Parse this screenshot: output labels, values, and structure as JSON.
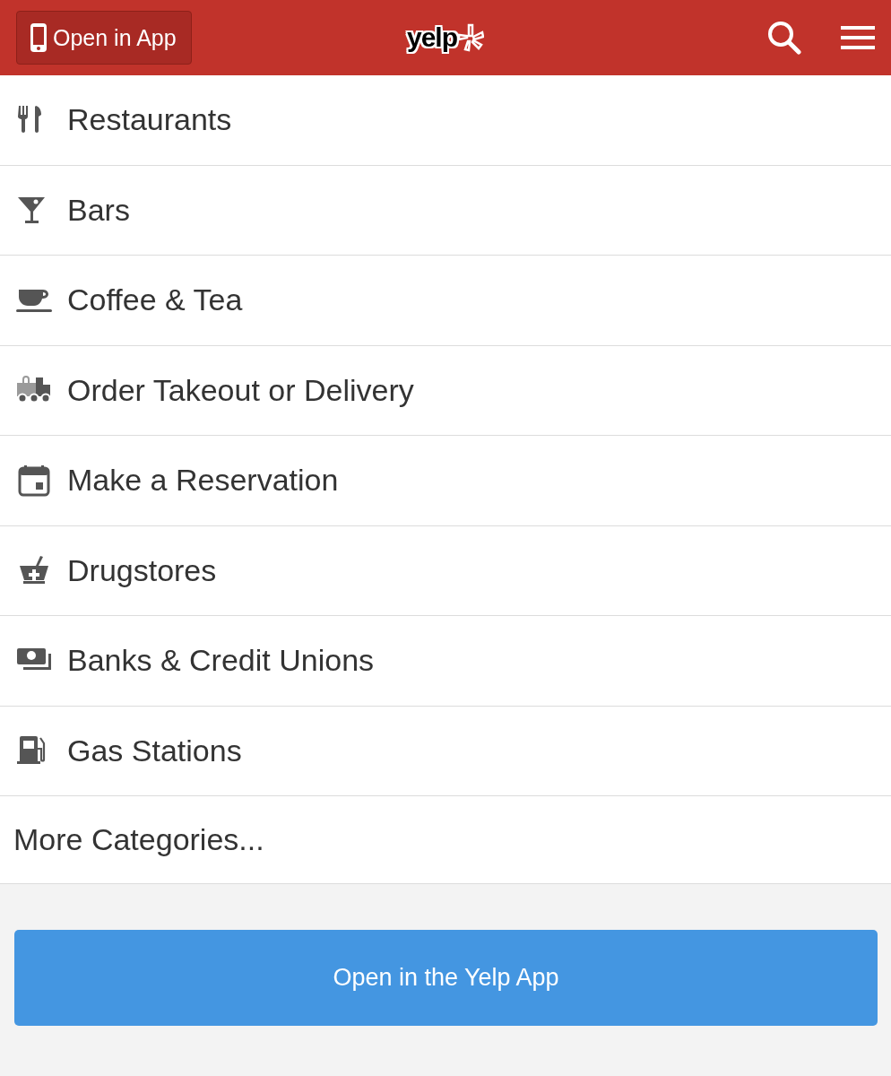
{
  "header": {
    "open_app_button": "Open in App",
    "logo": "yelp"
  },
  "categories": [
    {
      "kind": "dining",
      "label": "Restaurants"
    },
    {
      "kind": "drinks",
      "label": "Bars"
    },
    {
      "kind": "coffee",
      "label": "Coffee & Tea"
    },
    {
      "kind": "delivery",
      "label": "Order Takeout or Delivery"
    },
    {
      "kind": "reservation",
      "label": "Make a Reservation"
    },
    {
      "kind": "pharmacy",
      "label": "Drugstores"
    },
    {
      "kind": "bank",
      "label": "Banks & Credit Unions"
    },
    {
      "kind": "gas",
      "label": "Gas Stations"
    },
    {
      "kind": "more",
      "label": "More Categories..."
    }
  ],
  "app_button": "Open in the Yelp App"
}
